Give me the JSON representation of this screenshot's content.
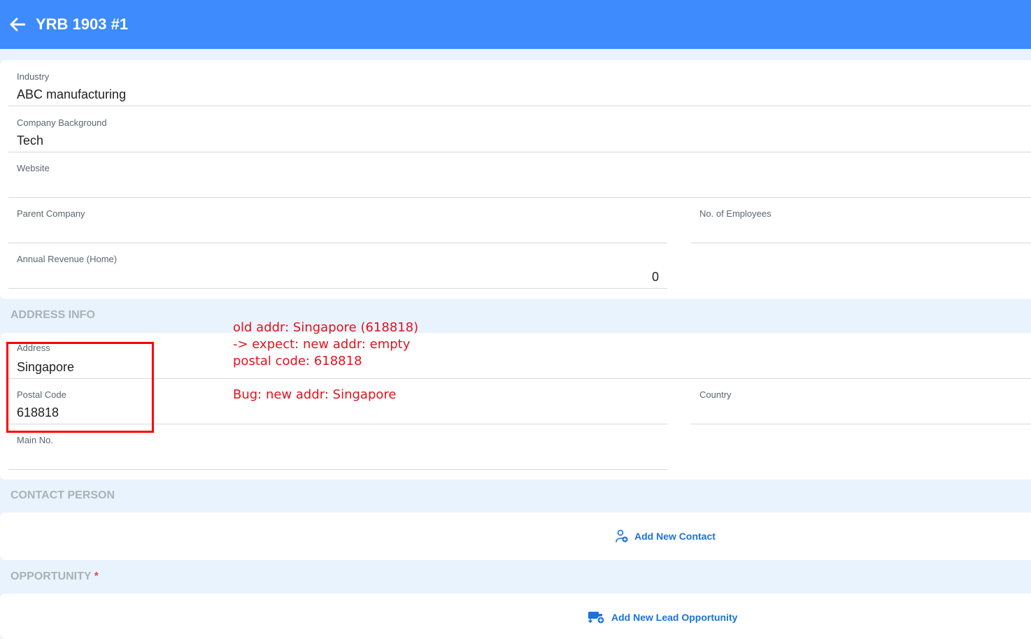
{
  "header": {
    "title": "YRB 1903 #1"
  },
  "company": {
    "industry": {
      "label": "Industry",
      "value": "ABC manufacturing"
    },
    "background": {
      "label": "Company Background",
      "value": "Tech"
    },
    "website": {
      "label": "Website",
      "value": ""
    },
    "parent_company": {
      "label": "Parent Company",
      "value": ""
    },
    "employees": {
      "label": "No. of Employees",
      "value": ""
    },
    "annual_revenue": {
      "label": "Annual Revenue (Home)",
      "value": "0"
    }
  },
  "address_info": {
    "section_title": "ADDRESS INFO",
    "address": {
      "label": "Address",
      "value": "Singapore"
    },
    "postal_code": {
      "label": "Postal Code",
      "value": "618818"
    },
    "country": {
      "label": "Country",
      "value": ""
    },
    "main_no": {
      "label": "Main No.",
      "value": ""
    }
  },
  "contact_person": {
    "section_title": "CONTACT PERSON",
    "add_label": "Add New Contact"
  },
  "opportunity": {
    "section_title": "OPPORTUNITY",
    "required_mark": "*",
    "add_label": "Add New Lead Opportunity"
  },
  "annotation": {
    "line1": "old addr: Singapore (618818)",
    "line2": "-> expect: new addr: empty",
    "line3": "postal code: 618818",
    "line4": "Bug: new addr: Singapore"
  },
  "colors": {
    "header": "#3d8bfd",
    "accent": "#1a73d9",
    "annotation": "#e0141e"
  }
}
